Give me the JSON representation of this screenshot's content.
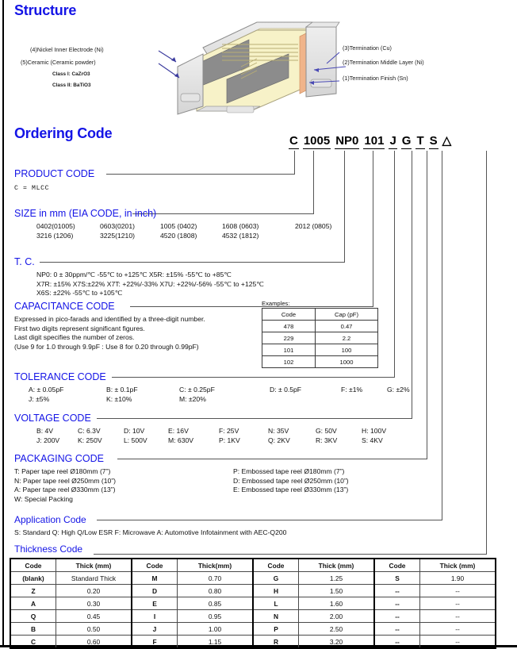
{
  "frame": {
    "accent": "#1414e6",
    "line": "#555555"
  },
  "structure": {
    "title": "Structure",
    "labels": {
      "nickel_inner_electrode": "(4)Nickel Inner Electrode (Ni)",
      "ceramic": "(5)Ceramic (Ceramic powder)",
      "class1": "Class I: CaZrO3",
      "class2": "Class II: BaTiO3",
      "termination_cu": "(3)Termination (Cu)",
      "termination_middle": "(2)Termination Middle Layer (Ni)",
      "termination_finish": "(1)Termination Finish (Sn)"
    },
    "colors": {
      "ceramic": "#f7f2c8",
      "cut_face": "#8a8a8a",
      "shell": "#e2e2e2",
      "termination": "#f0b48a"
    }
  },
  "ordering": {
    "title": "Ordering Code",
    "segments": [
      {
        "name": "product",
        "text": "C"
      },
      {
        "name": "size",
        "text": "1005"
      },
      {
        "name": "tc",
        "text": "NP0"
      },
      {
        "name": "capacitance",
        "text": "101"
      },
      {
        "name": "tolerance",
        "text": "J"
      },
      {
        "name": "voltage",
        "text": "G"
      },
      {
        "name": "packaging",
        "text": "T"
      },
      {
        "name": "application",
        "text": "S"
      },
      {
        "name": "thickness",
        "text": "△"
      }
    ],
    "product_code": {
      "head": "PRODUCT CODE",
      "lines": [
        "C  =  MLCC"
      ]
    },
    "size_code": {
      "head": "SIZE in mm (EIA CODE, in inch)",
      "row1": [
        "0402(01005)",
        "0603(0201)",
        "1005 (0402)",
        "1608 (0603)",
        "2012 (0805)"
      ],
      "row2": [
        "3216 (1206)",
        "3225(1210)",
        "4520 (1808)",
        "4532 (1812)"
      ]
    },
    "tc_code": {
      "head": "T. C.",
      "lines": [
        "NP0: 0 ± 30ppm/℃   -55℃  to +125℃        X5R: ±15%    -55℃  to +85℃",
        "X7R: ±15%   X7S:±22%   X7T: +22%/-33%   X7U: +22%/-56%    -55℃  to +125℃",
        "X6S: ±22%      -55℃  to +105℃"
      ]
    },
    "capacitance_code": {
      "head": "CAPACITANCE CODE",
      "lines": [
        "Expressed in pico-farads and identified by a three-digit number.",
        "First two digits represent significant figures.",
        "Last digit specifies the number of zeros.",
        "(Use 9 for 1.0 through 9.9pF :   Use 8 for 0.20 through 0.99pF)"
      ],
      "examples_caption": "Examples:",
      "examples_headers": [
        "Code",
        "Cap (pF)"
      ],
      "examples_rows": [
        [
          "478",
          "0.47"
        ],
        [
          "229",
          "2.2"
        ],
        [
          "101",
          "100"
        ],
        [
          "102",
          "1000"
        ]
      ]
    },
    "tolerance_code": {
      "head": "TOLERANCE CODE",
      "row1": [
        "A: ± 0.05pF",
        "B: ± 0.1pF",
        "C: ± 0.25pF",
        "D: ± 0.5pF",
        "F: ±1%",
        "G: ±2%"
      ],
      "row2": [
        "J: ±5%",
        "K: ±10%",
        "M: ±20%"
      ]
    },
    "voltage_code": {
      "head": "VOLTAGE CODE",
      "row1": [
        "B: 4V",
        "C: 6.3V",
        "D: 10V",
        "E: 16V",
        "F: 25V",
        "N: 35V",
        "G: 50V",
        "H: 100V"
      ],
      "row2": [
        "J: 200V",
        "K: 250V",
        "L: 500V",
        "M: 630V",
        "P: 1KV",
        "Q: 2KV",
        "R: 3KV",
        "S: 4KV"
      ]
    },
    "packaging_code": {
      "head": "PACKAGING CODE",
      "left": [
        "T: Paper tape reel Ø180mm (7”)",
        "N: Paper tape reel Ø250mm (10”)",
        "A: Paper tape reel Ø330mm (13”)",
        "W: Special Packing"
      ],
      "right": [
        "P: Embossed tape reel Ø180mm (7”)",
        "D: Embossed tape reel Ø250mm (10”)",
        "E: Embossed tape reel Ø330mm (13”)"
      ]
    },
    "application_code": {
      "head": "Application Code",
      "lines": [
        "S: Standard   Q: High Q/Low ESR  F: Microwave A: Automotive Infotainment with AEC-Q200"
      ]
    },
    "thickness_code": {
      "head": "Thickness Code",
      "headers": [
        "Code",
        "Thick (mm)",
        "Code",
        "Thick(mm)",
        "Code",
        "Thick (mm)",
        "Code",
        "Thick (mm)"
      ],
      "rows": [
        [
          "(blank)",
          "Standard Thick",
          "M",
          "0.70",
          "G",
          "1.25",
          "S",
          "1.90"
        ],
        [
          "Z",
          "0.20",
          "D",
          "0.80",
          "H",
          "1.50",
          "--",
          "--"
        ],
        [
          "A",
          "0.30",
          "E",
          "0.85",
          "L",
          "1.60",
          "--",
          "--"
        ],
        [
          "Q",
          "0.45",
          "I",
          "0.95",
          "N",
          "2.00",
          "--",
          "--"
        ],
        [
          "B",
          "0.50",
          "J",
          "1.00",
          "P",
          "2.50",
          "--",
          "--"
        ],
        [
          "C",
          "0.60",
          "F",
          "1.15",
          "R",
          "3.20",
          "--",
          "--"
        ]
      ]
    }
  }
}
